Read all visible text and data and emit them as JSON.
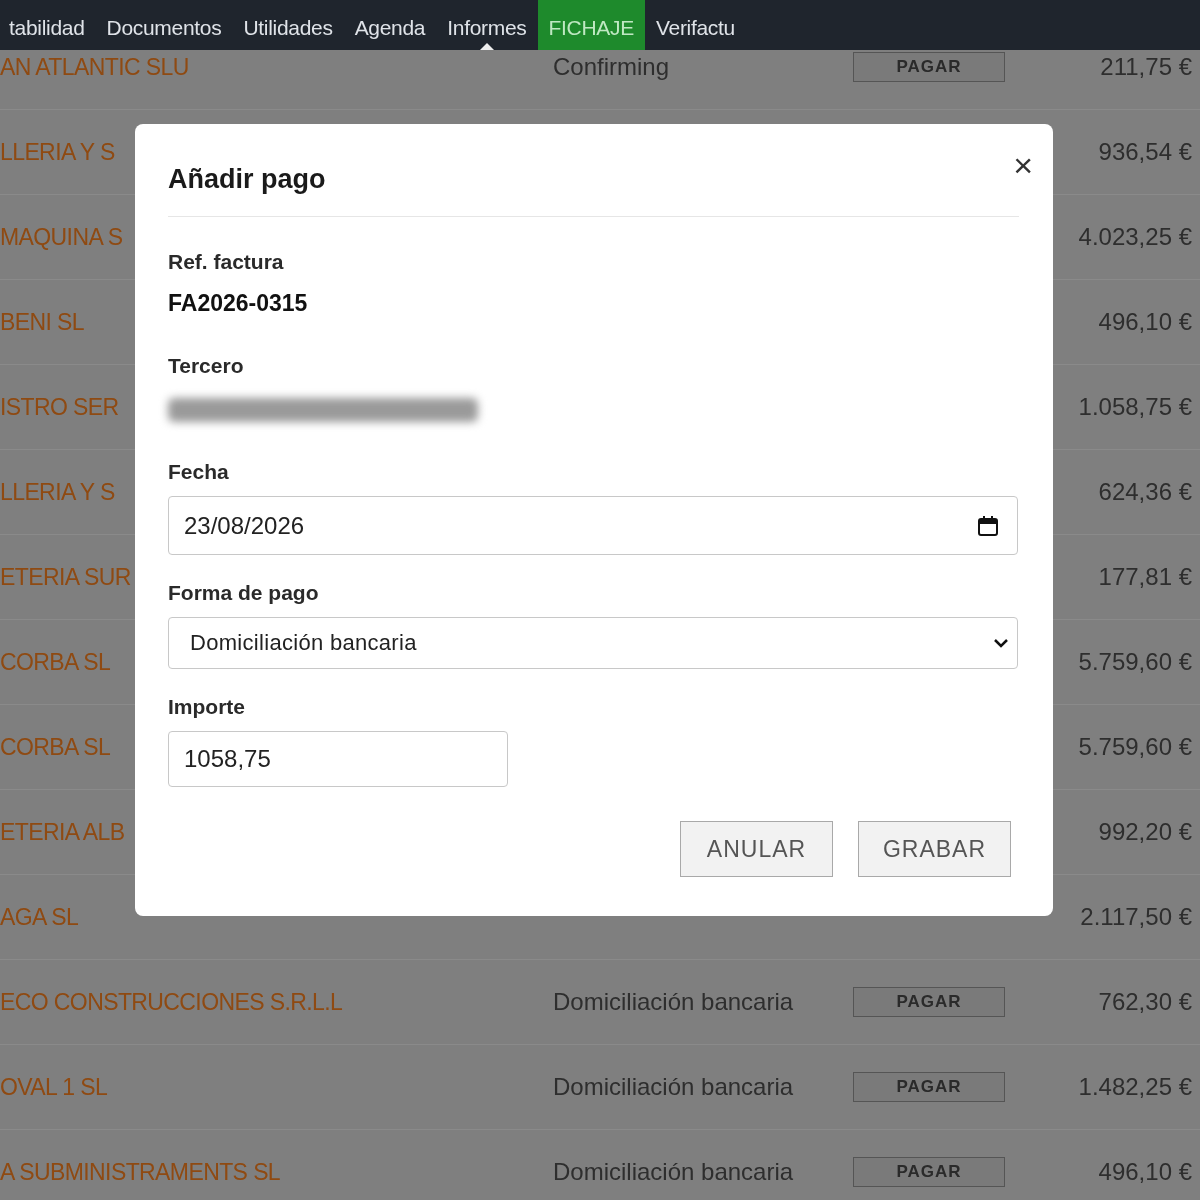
{
  "nav": {
    "items": [
      {
        "label": "tabilidad",
        "selected": false,
        "highlight": false
      },
      {
        "label": "Documentos",
        "selected": false,
        "highlight": false
      },
      {
        "label": "Utilidades",
        "selected": false,
        "highlight": false
      },
      {
        "label": "Agenda",
        "selected": false,
        "highlight": false
      },
      {
        "label": "Informes",
        "selected": true,
        "highlight": false
      },
      {
        "label": "FICHAJE",
        "selected": false,
        "highlight": true
      },
      {
        "label": "Verifactu",
        "selected": false,
        "highlight": false
      }
    ]
  },
  "table": {
    "rows": [
      {
        "name": "AN ATLANTIC SLU",
        "method": "Confirming",
        "button": "PAGAR",
        "amount": "211,75 €"
      },
      {
        "name": "LLERIA Y S",
        "amount": "936,54 €"
      },
      {
        "name": "MAQUINA S",
        "amount": "4.023,25 €"
      },
      {
        "name": "BENI SL",
        "amount": "496,10 €"
      },
      {
        "name": "ISTRO SER",
        "amount": "1.058,75 €"
      },
      {
        "name": "LLERIA Y S",
        "amount": "624,36 €"
      },
      {
        "name": "ETERIA SUR",
        "amount": "177,81 €"
      },
      {
        "name": "CORBA SL",
        "amount": "5.759,60 €"
      },
      {
        "name": "CORBA SL",
        "amount": "5.759,60 €"
      },
      {
        "name": "ETERIA ALB",
        "amount": "992,20 €"
      },
      {
        "name": "AGA SL",
        "amount": "2.117,50 €"
      },
      {
        "name": "ECO CONSTRUCCIONES S.R.L.L",
        "method": "Domiciliación bancaria",
        "button": "PAGAR",
        "amount": "762,30 €"
      },
      {
        "name": "OVAL 1 SL",
        "method": "Domiciliación bancaria",
        "button": "PAGAR",
        "amount": "1.482,25 €"
      },
      {
        "name": "A SUBMINISTRAMENTS SL",
        "method": "Domiciliación bancaria",
        "button": "PAGAR",
        "amount": "496,10 €"
      }
    ]
  },
  "dialog": {
    "title": "Añadir pago",
    "close": "×",
    "ref_label": "Ref. factura",
    "ref_value": "FA2026-0315",
    "tercero_label": "Tercero",
    "fecha_label": "Fecha",
    "fecha_value": "23/08/2026",
    "forma_label": "Forma de pago",
    "forma_value": "Domiciliación bancaria",
    "importe_label": "Importe",
    "importe_value": "1058,75",
    "buttons": [
      "ANULAR",
      "GRABAR"
    ]
  }
}
